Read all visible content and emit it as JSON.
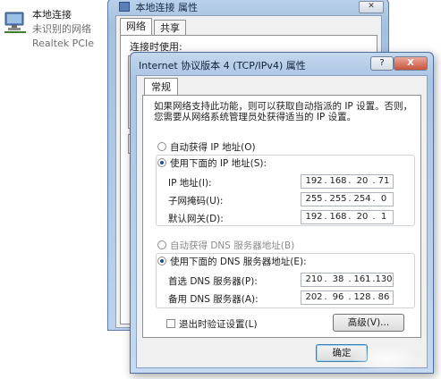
{
  "adapter": {
    "name": "本地连接",
    "status": "未识别的网络",
    "device": "Realtek PCIe"
  },
  "back_dialog": {
    "title": "本地连接 属性",
    "tabs": [
      "网络",
      "共享"
    ],
    "first_line": "连接时使用:"
  },
  "dialog": {
    "title": "Internet 协议版本 4 (TCP/IPv4) 属性",
    "help_button": "?",
    "close_button": "X",
    "tab": "常规",
    "description_line1": "如果网络支持此功能，则可以获取自动指派的 IP 设置。否则，",
    "description_line2": "您需要从网络系统管理员处获得适当的 IP 设置。",
    "ip_auto_label": "自动获得 IP 地址(O)",
    "ip_manual_label": "使用下面的 IP 地址(S):",
    "ip_address_label": "IP 地址(I):",
    "subnet_label": "子网掩码(U):",
    "gateway_label": "默认网关(D):",
    "dns_auto_label": "自动获得 DNS 服务器地址(B)",
    "dns_manual_label": "使用下面的 DNS 服务器地址(E):",
    "preferred_dns_label": "首选 DNS 服务器(P):",
    "alternate_dns_label": "备用 DNS 服务器(A):",
    "validate_label": "退出时验证设置(L)",
    "advanced_button": "高级(V)...",
    "ok_button": "确定"
  },
  "values": {
    "ip_address": [
      "192",
      "168",
      "20",
      "71"
    ],
    "subnet_mask": [
      "255",
      "255",
      "254",
      "0"
    ],
    "gateway": [
      "192",
      "168",
      "20",
      "1"
    ],
    "preferred_dns": [
      "210",
      "38",
      "161",
      "130"
    ],
    "alternate_dns": [
      "202",
      "96",
      "128",
      "86"
    ]
  },
  "state": {
    "ip_mode": "manual",
    "dns_mode": "manual",
    "validate_on_exit": false
  },
  "colors": {
    "title_bar": "#aac4e3",
    "selected_radio": "#1c4e9a",
    "close_button": "#c8533c"
  },
  "icons": [
    "network-adapter-icon",
    "network-settings-icon"
  ]
}
